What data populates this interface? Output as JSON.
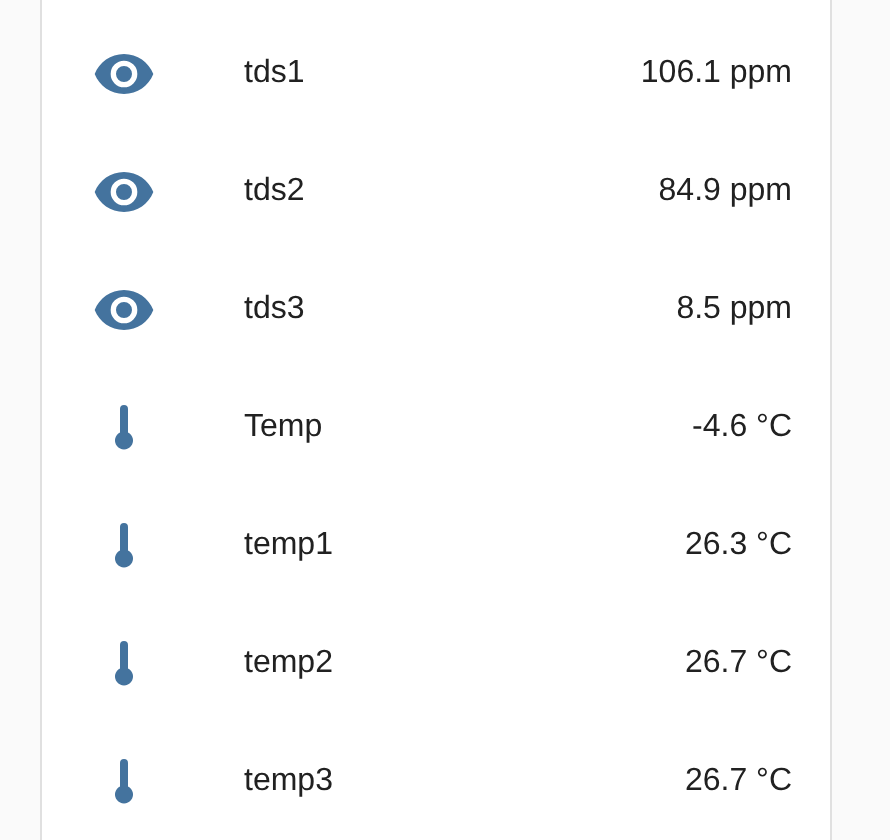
{
  "entities": [
    {
      "kind": "eye",
      "name": "tds1",
      "state": "106.1 ppm"
    },
    {
      "kind": "eye",
      "name": "tds2",
      "state": "84.9 ppm"
    },
    {
      "kind": "eye",
      "name": "tds3",
      "state": "8.5 ppm"
    },
    {
      "kind": "thermometer",
      "name": "Temp",
      "state": "-4.6 °C"
    },
    {
      "kind": "thermometer",
      "name": "temp1",
      "state": "26.3 °C"
    },
    {
      "kind": "thermometer",
      "name": "temp2",
      "state": "26.7 °C"
    },
    {
      "kind": "thermometer",
      "name": "temp3",
      "state": "26.7 °C"
    }
  ]
}
